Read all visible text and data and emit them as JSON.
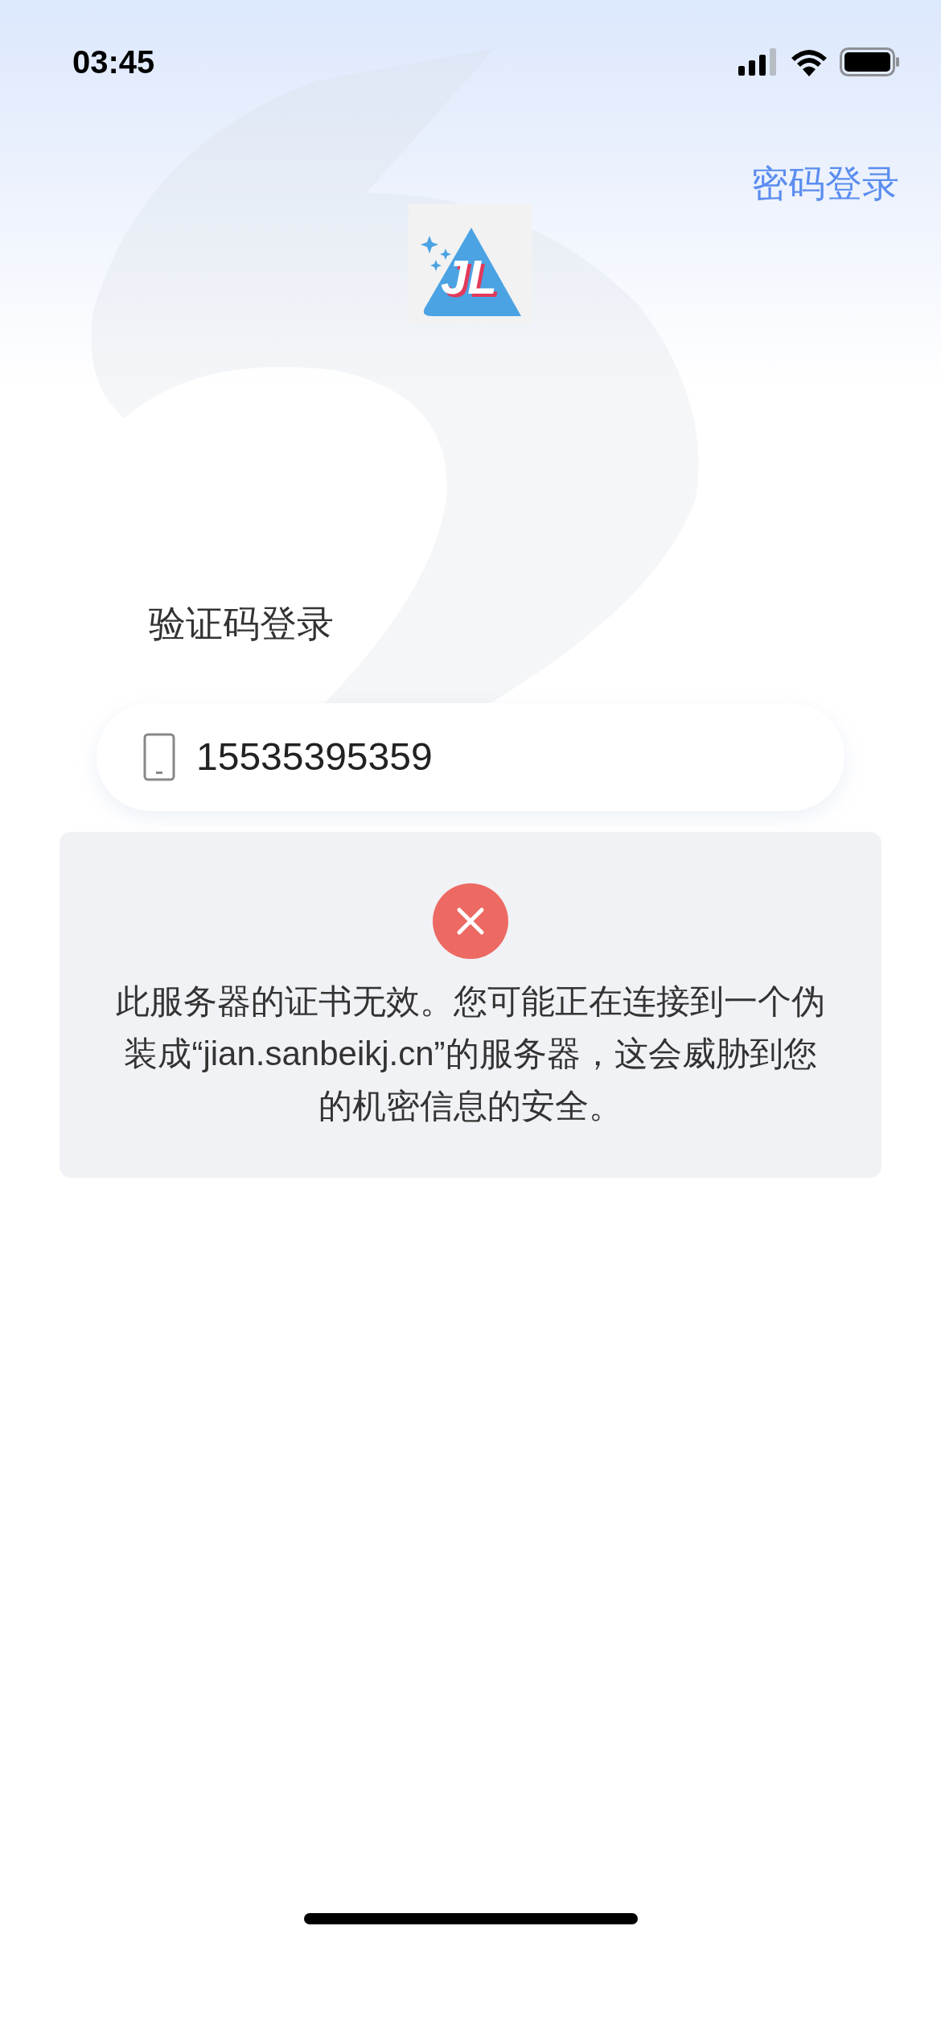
{
  "status_bar": {
    "time": "03:45"
  },
  "header": {
    "switch_link": "密码登录"
  },
  "logo": {
    "letters": "JL"
  },
  "title": "验证码登录",
  "phone_field": {
    "value": "15535395359"
  },
  "error_toast": {
    "message": "此服务器的证书无效。您可能正在连接到一个伪装成“jian.sanbeikj.cn”的服务器，这会威胁到您的机密信息的安全。"
  }
}
